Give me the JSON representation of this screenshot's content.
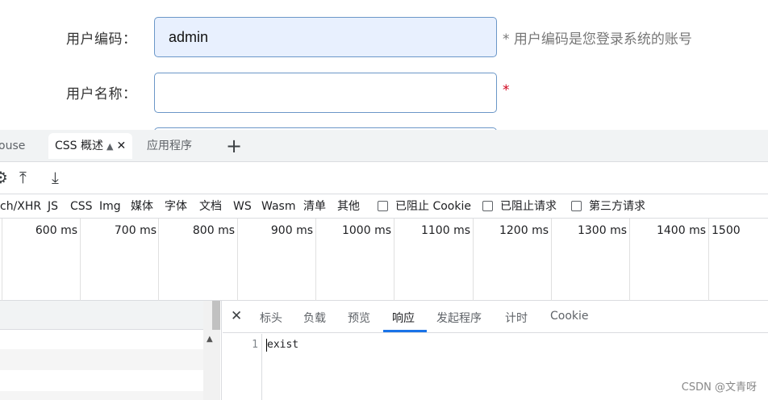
{
  "form": {
    "usercode_label": "用户编码：",
    "usercode_value": "admin",
    "usercode_hint": "* 用户编码是您登录系统的账号",
    "username_label": "用户名称：",
    "username_value": "",
    "required_mark": "*"
  },
  "devtools": {
    "tabs": [
      {
        "label": "ouse"
      },
      {
        "label": "CSS 概述"
      },
      {
        "label": "应用程序"
      }
    ],
    "filters": [
      "ch/XHR",
      "JS",
      "CSS",
      "Img",
      "媒体",
      "字体",
      "文档",
      "WS",
      "Wasm",
      "清单",
      "其他"
    ],
    "checkbox_filters": [
      "已阻止 Cookie",
      "已阻止请求",
      "第三方请求"
    ],
    "timeline_labels": [
      "600 ms",
      "700 ms",
      "800 ms",
      "900 ms",
      "1000 ms",
      "1100 ms",
      "1200 ms",
      "1300 ms",
      "1400 ms",
      "1500"
    ],
    "detail_tabs": [
      "标头",
      "负载",
      "预览",
      "响应",
      "发起程序",
      "计时",
      "Cookie"
    ],
    "active_detail_tab": "响应",
    "response": {
      "line_number": "1",
      "content": "exist"
    },
    "icons": {
      "upload": "upload-icon",
      "download": "download-icon",
      "close": "close-icon",
      "add": "add-tab-icon",
      "flask": "experiment-icon"
    }
  },
  "watermark": "CSDN @文青呀"
}
